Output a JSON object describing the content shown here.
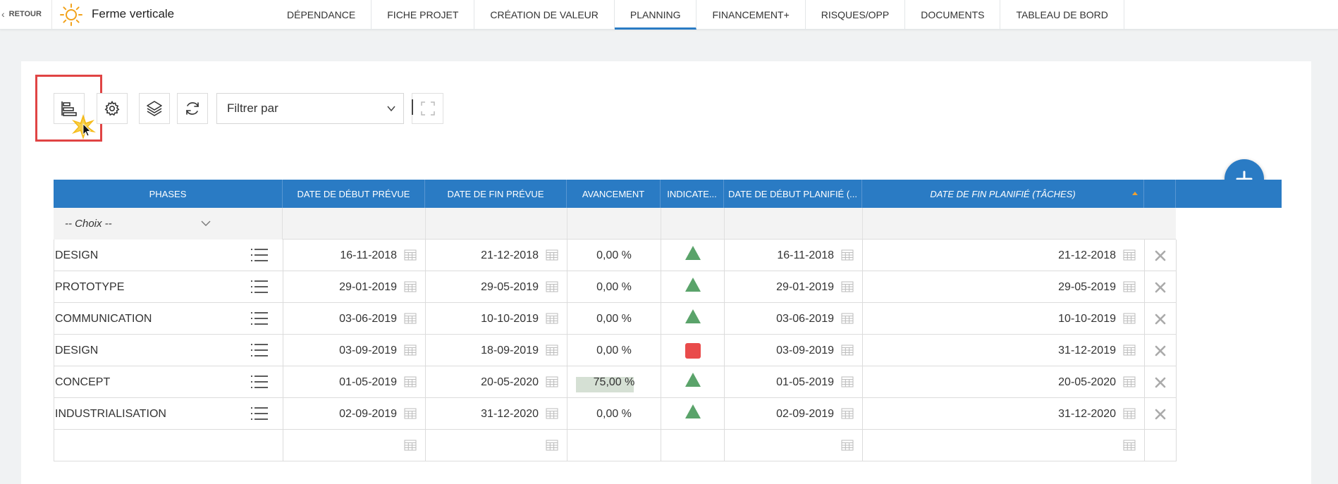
{
  "header": {
    "back_label": "RETOUR",
    "app_title": "Ferme verticale",
    "tabs": [
      {
        "label": "DÉPENDANCE"
      },
      {
        "label": "FICHE PROJET"
      },
      {
        "label": "CRÉATION DE VALEUR"
      },
      {
        "label": "PLANNING",
        "active": true
      },
      {
        "label": "FINANCEMENT+"
      },
      {
        "label": "RISQUES/OPP"
      },
      {
        "label": "DOCUMENTS"
      },
      {
        "label": "TABLEAU DE BORD"
      }
    ]
  },
  "toolbar": {
    "gantt_icon": "gantt-view-icon",
    "settings_icon": "gear-icon",
    "layers_icon": "layers-icon",
    "refresh_icon": "refresh-icon",
    "filter_value": "Filtrer par",
    "fullscreen_icon": "fullscreen-icon"
  },
  "table": {
    "columns": [
      "PHASES",
      "DATE DE DÉBUT PRÉVUE",
      "DATE DE FIN PRÉVUE",
      "AVANCEMENT",
      "INDICATE...",
      "DATE DE DÉBUT PLANIFIÉ (...",
      "DATE DE FIN PLANIFIÉ (TÂCHES)"
    ],
    "sorted_column": "DATE DE FIN PLANIFIÉ (TÂCHES)",
    "phase_filter": "-- Choix --",
    "rows": [
      {
        "phase": "DESIGN",
        "start_planned": "16-11-2018",
        "end_planned": "21-12-2018",
        "progress": "0,00 %",
        "progress_fraction": 0,
        "indicator": "green-triangle",
        "start_sched": "16-11-2018",
        "end_sched": "21-12-2018"
      },
      {
        "phase": "PROTOTYPE",
        "start_planned": "29-01-2019",
        "end_planned": "29-05-2019",
        "progress": "0,00 %",
        "progress_fraction": 0,
        "indicator": "green-triangle",
        "start_sched": "29-01-2019",
        "end_sched": "29-05-2019"
      },
      {
        "phase": "COMMUNICATION",
        "start_planned": "03-06-2019",
        "end_planned": "10-10-2019",
        "progress": "0,00 %",
        "progress_fraction": 0,
        "indicator": "green-triangle",
        "start_sched": "03-06-2019",
        "end_sched": "10-10-2019"
      },
      {
        "phase": "DESIGN",
        "start_planned": "03-09-2019",
        "end_planned": "18-09-2019",
        "progress": "0,00 %",
        "progress_fraction": 0,
        "indicator": "red-square",
        "start_sched": "03-09-2019",
        "end_sched": "31-12-2019"
      },
      {
        "phase": "CONCEPT",
        "start_planned": "01-05-2019",
        "end_planned": "20-05-2020",
        "progress": "75,00 %",
        "progress_fraction": 0.75,
        "indicator": "green-triangle",
        "start_sched": "01-05-2019",
        "end_sched": "20-05-2020"
      },
      {
        "phase": "INDUSTRIALISATION",
        "start_planned": "02-09-2019",
        "end_planned": "31-12-2020",
        "progress": "0,00 %",
        "progress_fraction": 0,
        "indicator": "green-triangle",
        "start_sched": "02-09-2019",
        "end_sched": "31-12-2020"
      }
    ]
  },
  "colors": {
    "primary": "#2a7bc4",
    "indicator_green": "#5aa36a",
    "indicator_red": "#e94b4b",
    "highlight": "#e04444"
  }
}
